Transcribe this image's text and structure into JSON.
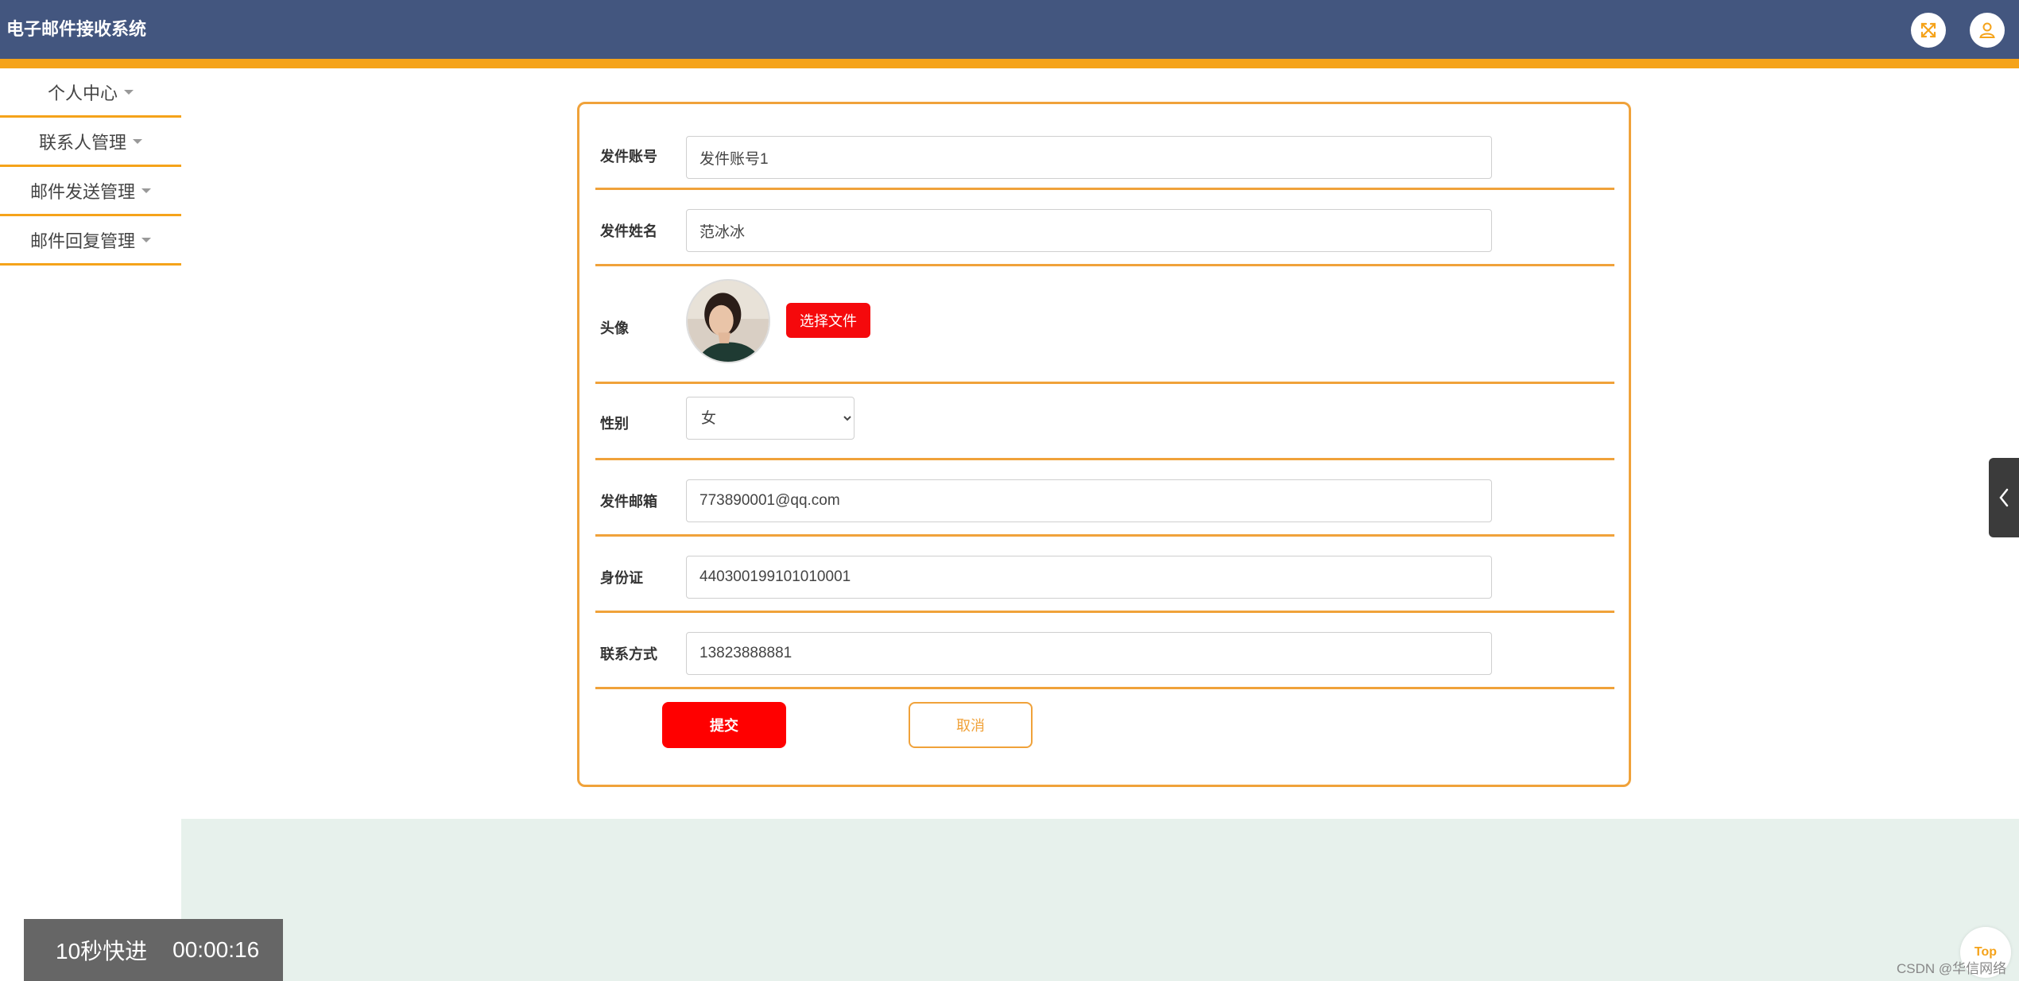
{
  "header": {
    "title": "电子邮件接收系统",
    "fullscreen_icon": "expand-arrows-icon",
    "user_icon": "user-icon",
    "colors": {
      "bar": "#43567f",
      "stripe": "#f5a31a"
    }
  },
  "sidebar": {
    "items": [
      {
        "label": "个人中心"
      },
      {
        "label": "联系人管理"
      },
      {
        "label": "邮件发送管理"
      },
      {
        "label": "邮件回复管理"
      }
    ]
  },
  "form": {
    "account": {
      "label": "发件账号",
      "value": "发件账号1"
    },
    "name": {
      "label": "发件姓名",
      "value": "范冰冰"
    },
    "avatar": {
      "label": "头像",
      "button": "选择文件"
    },
    "gender": {
      "label": "性别",
      "value": "女"
    },
    "email": {
      "label": "发件邮箱",
      "value": "773890001@qq.com"
    },
    "id_card": {
      "label": "身份证",
      "value": "440300199101010001"
    },
    "phone": {
      "label": "联系方式",
      "value": "13823888881"
    },
    "submit": "提交",
    "cancel": "取消"
  },
  "video": {
    "skip_label": "10秒快进",
    "time": "00:00:16"
  },
  "back_to_top": "Top",
  "watermark": "CSDN @华信网络"
}
